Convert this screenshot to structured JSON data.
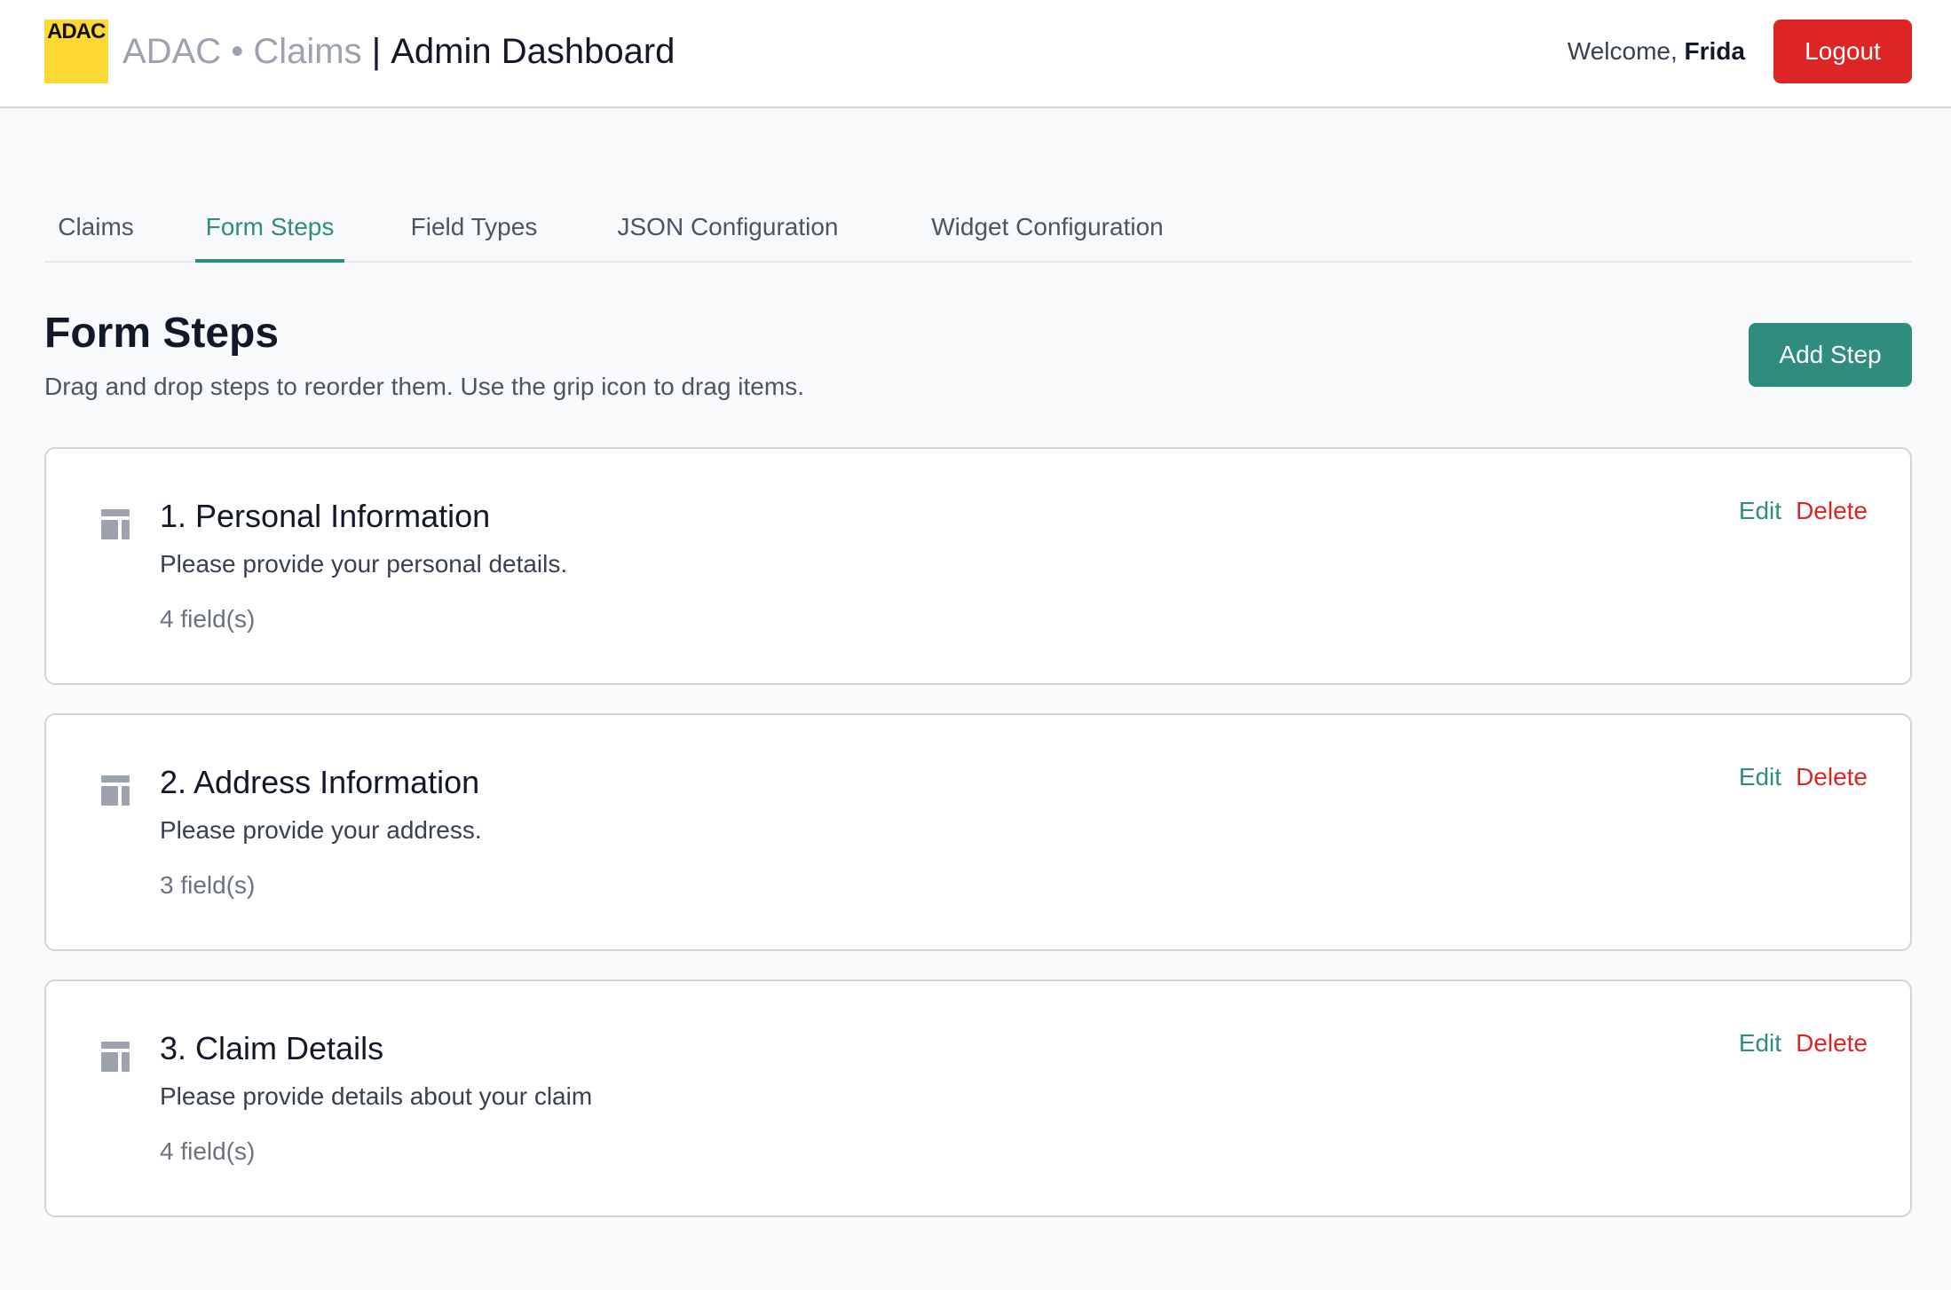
{
  "header": {
    "logo_text": "ADAC",
    "brand": "ADAC • Claims",
    "separator": " | ",
    "page_title": "Admin Dashboard",
    "welcome_prefix": "Welcome, ",
    "user_name": "Frida",
    "logout_label": "Logout"
  },
  "tabs": [
    {
      "label": "Claims",
      "active": false
    },
    {
      "label": "Form Steps",
      "active": true
    },
    {
      "label": "Field Types",
      "active": false
    },
    {
      "label": "JSON Configuration",
      "active": false
    },
    {
      "label": "Widget Configuration",
      "active": false
    }
  ],
  "section": {
    "title": "Form Steps",
    "description": "Drag and drop steps to reorder them. Use the grip icon to drag items.",
    "add_button_label": "Add Step"
  },
  "steps": [
    {
      "title": "1. Personal Information",
      "description": "Please provide your personal details.",
      "field_count": "4 field(s)",
      "edit_label": "Edit",
      "delete_label": "Delete",
      "icon": "grip-icon"
    },
    {
      "title": "2. Address Information",
      "description": "Please provide your address.",
      "field_count": "3 field(s)",
      "edit_label": "Edit",
      "delete_label": "Delete",
      "icon": "grip-icon"
    },
    {
      "title": "3. Claim Details",
      "description": "Please provide details about your claim",
      "field_count": "4 field(s)",
      "edit_label": "Edit",
      "delete_label": "Delete",
      "icon": "grip-icon"
    }
  ],
  "colors": {
    "accent": "#2f8c7f",
    "danger": "#dc2626",
    "logo": "#fcd835",
    "background": "#f9fafb"
  }
}
